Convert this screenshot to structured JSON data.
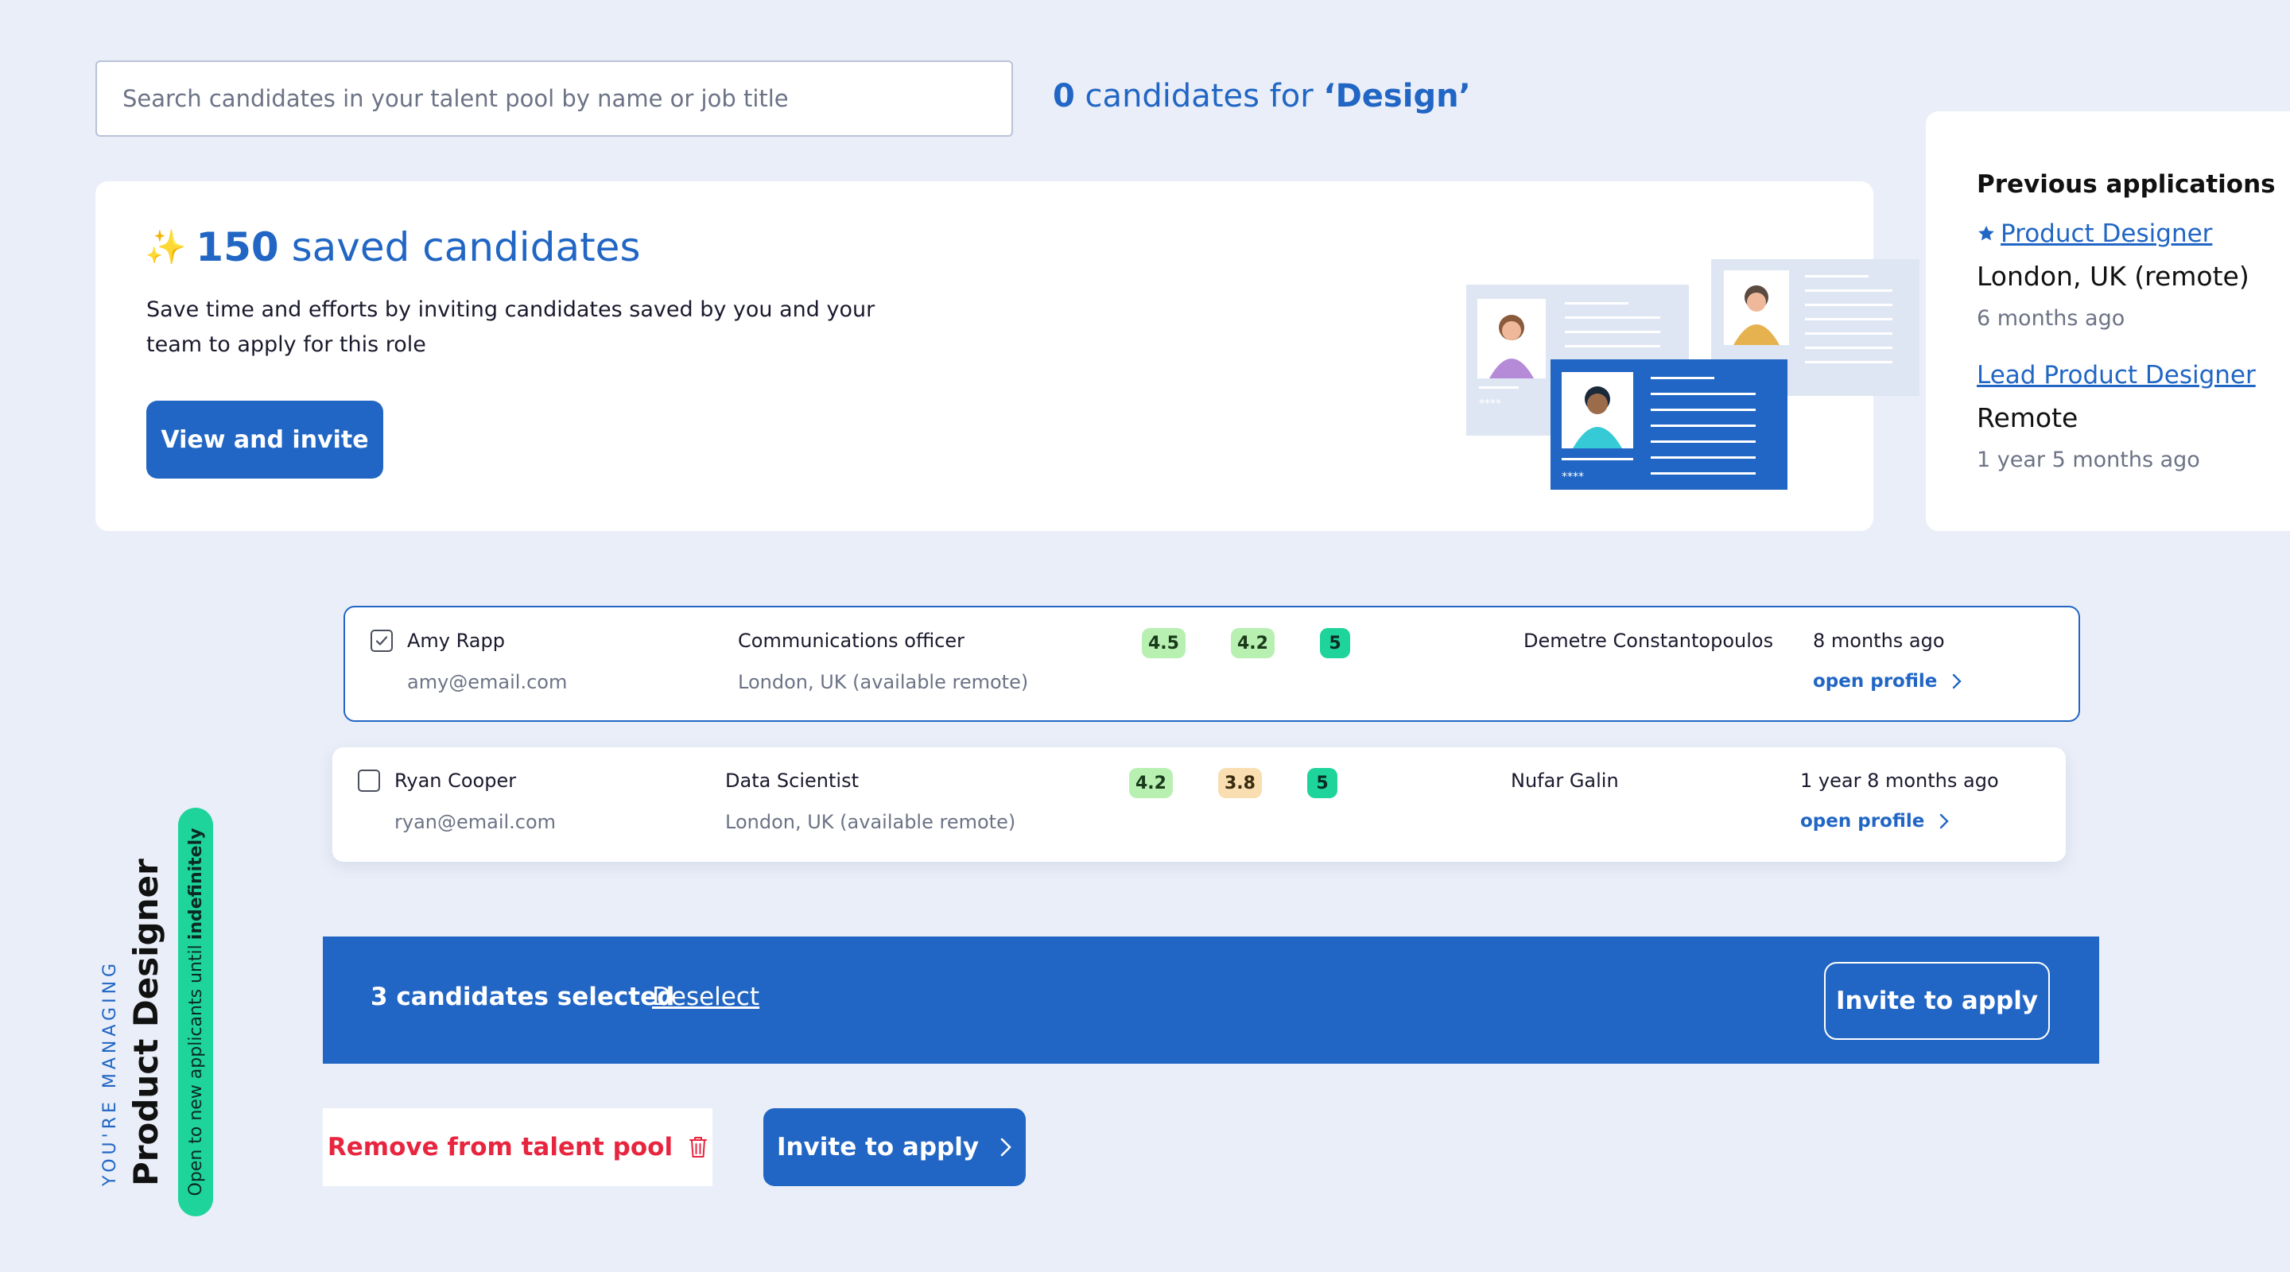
{
  "search": {
    "placeholder": "Search candidates in your talent pool by name or job title",
    "count": "0",
    "count_suffix": " candidates for ",
    "query": "‘Design’"
  },
  "saved": {
    "count": "150",
    "title_suffix": "saved candidates",
    "description": "Save time and efforts by inviting candidates saved by you and your team to apply for this role",
    "button": "View and invite",
    "sparkle_icon": "sparkles-icon",
    "card_ratings": "****"
  },
  "previous": {
    "title": "Previous applications",
    "items": [
      {
        "title": "Product Designer",
        "location": "London, UK (remote)",
        "time": "6 months ago",
        "starred": true
      },
      {
        "title": "Lead Product Designer",
        "location": "Remote",
        "time": "1 year 5 months ago",
        "starred": false
      }
    ]
  },
  "candidates": [
    {
      "name": "Amy Rapp",
      "email": "amy@email.com",
      "role": "Communications officer",
      "location": "London, UK (available remote)",
      "scores": [
        "4.5",
        "4.2",
        "5"
      ],
      "owner": "Demetre Constantopoulos",
      "time": "8 months ago",
      "checked": true,
      "open_label": "open profile"
    },
    {
      "name": "Ryan Cooper",
      "email": "ryan@email.com",
      "role": "Data Scientist",
      "location": "London, UK (available remote)",
      "scores": [
        "4.2",
        "3.8",
        "5"
      ],
      "owner": "Nufar Galin",
      "time": "1 year 8 months ago",
      "checked": false,
      "open_label": "open profile"
    }
  ],
  "selection": {
    "text": "3 candidates selected",
    "deselect": "Deselect",
    "invite": "Invite to apply"
  },
  "actions": {
    "remove": "Remove from talent pool",
    "invite": "Invite to apply"
  },
  "managing": {
    "label": "YOU'RE MANAGING",
    "role": "Product Designer",
    "status_prefix": "Open to new applicants until",
    "status_value": "indefinitely"
  },
  "colors": {
    "primary": "#2166c4",
    "background": "#e9eef8",
    "danger": "#e8253f",
    "score_light_green": "#b7f0b1",
    "score_peach": "#f8deb0",
    "score_teal": "#1ed49b",
    "status_green": "#1ed49b"
  }
}
